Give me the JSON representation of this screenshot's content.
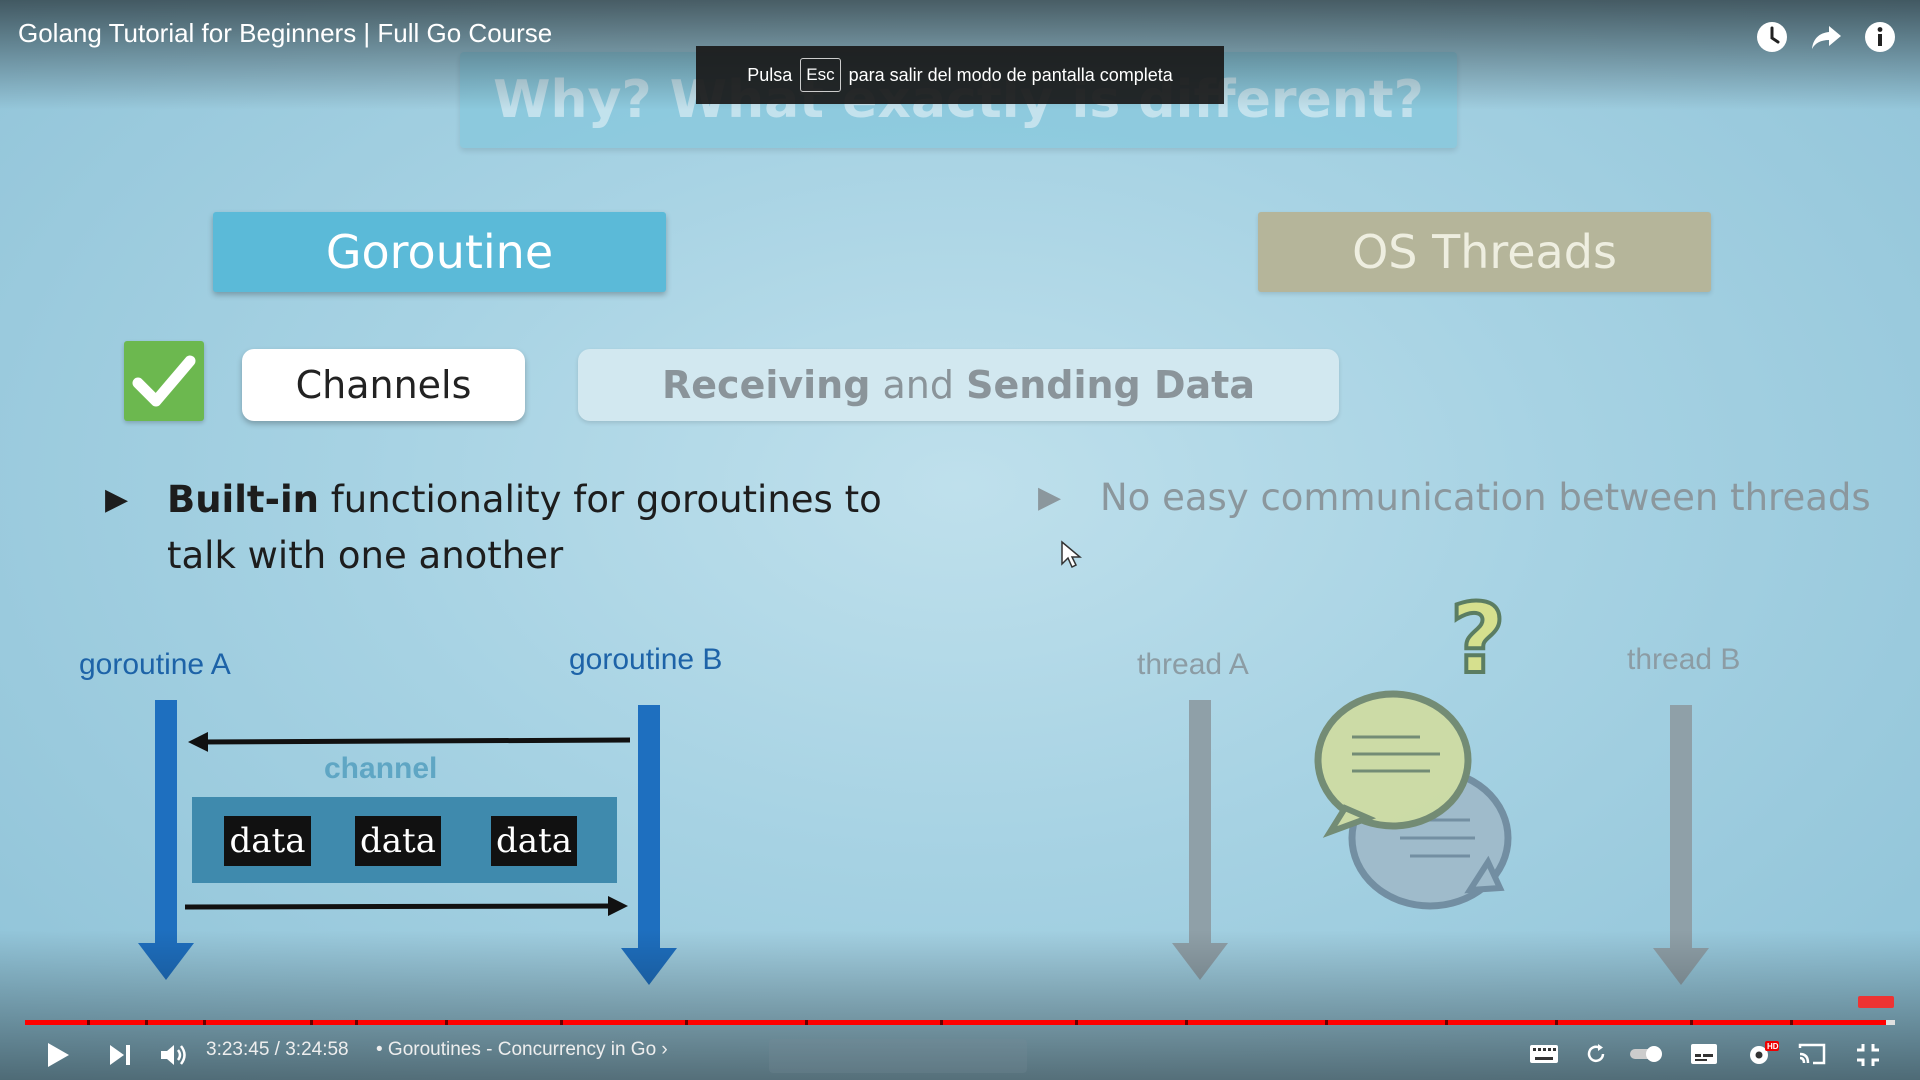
{
  "player": {
    "title": "Golang Tutorial for Beginners | Full Go Course",
    "time": "3:23:45 / 3:24:58",
    "chapter": "• Goroutines - Concurrency in Go ›",
    "progress": 0.995,
    "top_icons": [
      "clock-icon",
      "share-icon",
      "info-icon"
    ]
  },
  "fullscreen_toast": {
    "prefix": "Pulsa",
    "key": "Esc",
    "suffix": "para salir del modo de pantalla completa"
  },
  "slide": {
    "title": "Why? What exactly is different?",
    "left_heading": "Goroutine",
    "right_heading": "OS Threads",
    "channels": "Channels",
    "recv_bold1": "Receiving",
    "recv_mid": " and ",
    "recv_bold2": "Sending Data",
    "bullet_left_bold": "Built-in",
    "bullet_left_rest": " functionality for goroutines to talk with one another",
    "bullet_right": "No easy communication between threads",
    "goroutine_a": "goroutine A",
    "goroutine_b": "goroutine B",
    "channel_label": "channel",
    "data_chips": [
      "data",
      "data",
      "data"
    ],
    "thread_a": "thread A",
    "thread_b": "thread B",
    "question_mark": "?"
  }
}
